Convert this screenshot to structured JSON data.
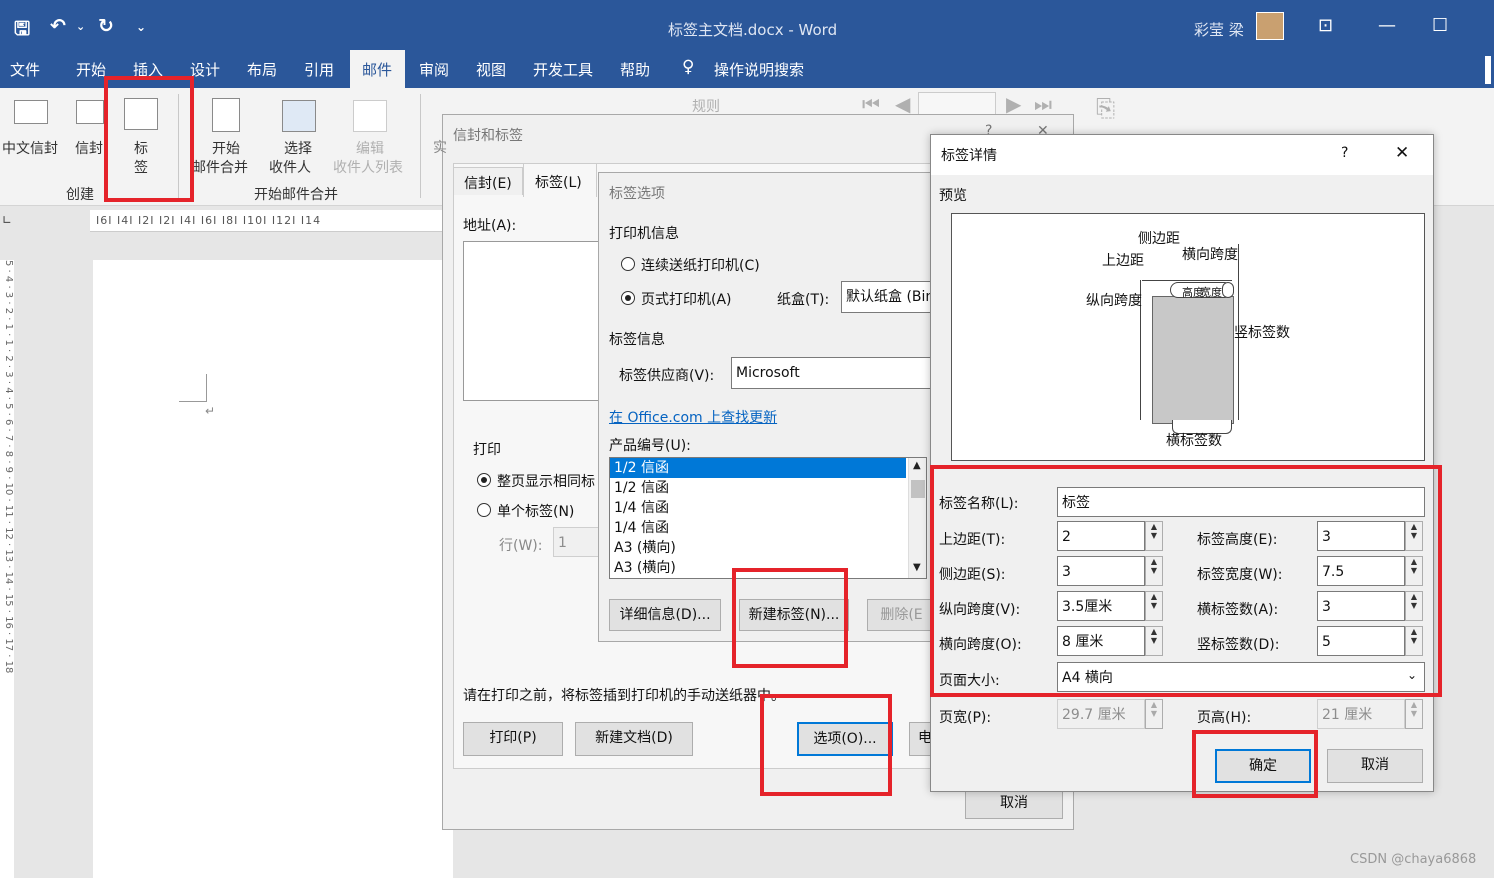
{
  "window": {
    "title": "标签主文档.docx  -  Word",
    "user": "彩莹 梁"
  },
  "quick_access": {
    "save_icon": "save-icon",
    "undo_icon": "undo-icon",
    "redo_icon": "redo-icon"
  },
  "menu": [
    "文件",
    "开始",
    "插入",
    "设计",
    "布局",
    "引用",
    "邮件",
    "审阅",
    "视图",
    "开发工具",
    "帮助",
    "操作说明搜索"
  ],
  "ribbon": {
    "chinese_envelope": "中文信封",
    "envelope": "信封",
    "labels_1": "标",
    "labels_2": "签",
    "group_create": "创建",
    "start_merge_1": "开始",
    "start_merge_2": "邮件合并",
    "select_recipients_1": "选择",
    "select_recipients_2": "收件人",
    "edit_recipients_1": "编辑",
    "edit_recipients_2": "收件人列表",
    "group_start_merge": "开始邮件合并",
    "rules": "规则"
  },
  "ruler": "I6I I4I I2I    I2I I4I I6I I8I I10I I12I I14",
  "vruler": "5 · 4 · 3 · 2 · 1 · 1 · 2 · 3 · 4 · 5 · 6 · 7 · 8 · 9 · 10 · 11 · 12 · 13 · 14 · 15 · 16 · 17 · 18",
  "env_dialog": {
    "title": "信封和标签",
    "tab_envelopes": "信封(E)",
    "tab_labels": "标签(L)",
    "address_label": "地址(A):",
    "print_group": "打印",
    "full_page": "整页显示相同标",
    "single_label": "单个标签(N)",
    "row_label": "行(W):",
    "row_value": "1",
    "instruction": "请在打印之前，将标签插到打印机的手动送纸器中。",
    "print_button": "打印(P)",
    "new_doc_button": "新建文档(D)",
    "options_button": "选项(O)...",
    "cut_button": "电",
    "cancel_button": "取消",
    "hidden_char": "实"
  },
  "opt_dialog": {
    "title": "标签选项",
    "printer_info": "打印机信息",
    "continuous": "连续送纸打印机(C)",
    "page_printer": "页式打印机(A)",
    "tray_label": "纸盒(T):",
    "tray_value": "默认纸盒 (Bin",
    "label_info": "标签信息",
    "vendor_label": "标签供应商(V):",
    "vendor_value": "Microsoft",
    "update_link": "在 Office.com 上查找更新",
    "product_label": "产品编号(U):",
    "products": [
      "1/2 信函",
      "1/2 信函",
      "1/4 信函",
      "1/4 信函",
      "A3 (横向)",
      "A3 (横向)"
    ],
    "details_button": "详细信息(D)...",
    "new_label_button": "新建标签(N)...",
    "delete_button": "删除(E"
  },
  "detail_dialog": {
    "title": "标签详情",
    "help": "?",
    "preview_label": "预览",
    "diagram": {
      "side_margin": "侧边距",
      "top_margin": "上边距",
      "horiz_pitch": "横向跨度",
      "vert_pitch": "纵向跨度",
      "height": "高度",
      "width": "宽度",
      "rows": "竖标签数",
      "cols": "横标签数"
    },
    "name_label": "标签名称(L):",
    "name_value": "标签",
    "top_margin_label": "上边距(T):",
    "top_margin_value": "2",
    "side_margin_label": "侧边距(S):",
    "side_margin_value": "3",
    "vert_pitch_label": "纵向跨度(V):",
    "vert_pitch_value": "3.5厘米",
    "horiz_pitch_label": "横向跨度(O):",
    "horiz_pitch_value": "8 厘米",
    "label_height_label": "标签高度(E):",
    "label_height_value": "3",
    "label_width_label": "标签宽度(W):",
    "label_width_value": "7.5",
    "across_label": "横标签数(A):",
    "across_value": "3",
    "down_label": "竖标签数(D):",
    "down_value": "5",
    "page_size_label": "页面大小:",
    "page_size_value": "A4 横向",
    "page_width_label": "页宽(P):",
    "page_width_value": "29.7 厘米",
    "page_height_label": "页高(H):",
    "page_height_value": "21 厘米",
    "ok_button": "确定",
    "cancel_button": "取消"
  },
  "watermark": "CSDN @chaya6868",
  "colors": {
    "accent": "#2b579a",
    "highlight": "#e5232a",
    "selection": "#0078d7"
  }
}
